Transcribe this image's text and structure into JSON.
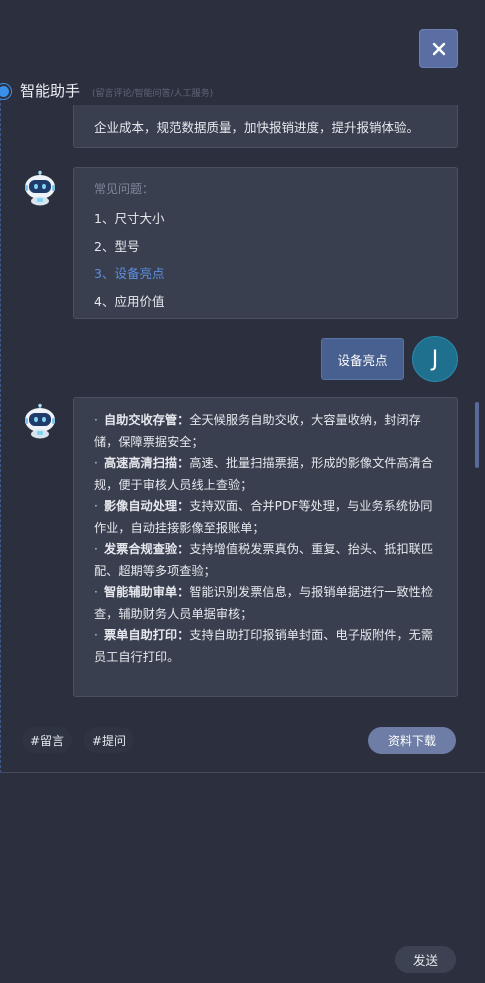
{
  "header": {
    "title": "智能助手",
    "subtitle": "(留言评论/智能问答/人工服务)"
  },
  "messages": {
    "previous_text": "企业成本，规范数据质量，加快报销进度，提升报销体验。",
    "faq": {
      "heading": "常见问题：",
      "items": [
        "1、尺寸大小",
        "2、型号",
        "3、设备亮点",
        "4、应用价值"
      ]
    },
    "user_message": "设备亮点",
    "user_avatar_letter": "J",
    "features": [
      {
        "bold": "自助交收存管：",
        "text": "全天候服务自助交收，大容量收纳，封闭存储，保障票据安全；"
      },
      {
        "bold": "高速高清扫描：",
        "text": "高速、批量扫描票据，形成的影像文件高清合规，便于审核人员线上查验；"
      },
      {
        "bold": "影像自动处理：",
        "text": "支持双面、合并PDF等处理，与业务系统协同作业，自动挂接影像至报账单；"
      },
      {
        "bold": "发票合规查验：",
        "text": "支持增值税发票真伪、重复、抬头、抵扣联匹配、超期等多项查验；"
      },
      {
        "bold": "智能辅助审单：",
        "text": "智能识别发票信息，与报销单据进行一致性检查，辅助财务人员单据审核；"
      },
      {
        "bold": "票单自助打印：",
        "text": "支持自助打印报销单封面、电子版附件，无需员工自行打印。"
      }
    ]
  },
  "actions": {
    "tags": [
      "#留言",
      "#提问"
    ],
    "download_label": "资料下载",
    "send_label": "发送"
  },
  "colors": {
    "background": "#2c303e",
    "bubble": "#3a3f4f",
    "accent": "#5b8fe0",
    "user_bubble": "#47608f"
  }
}
